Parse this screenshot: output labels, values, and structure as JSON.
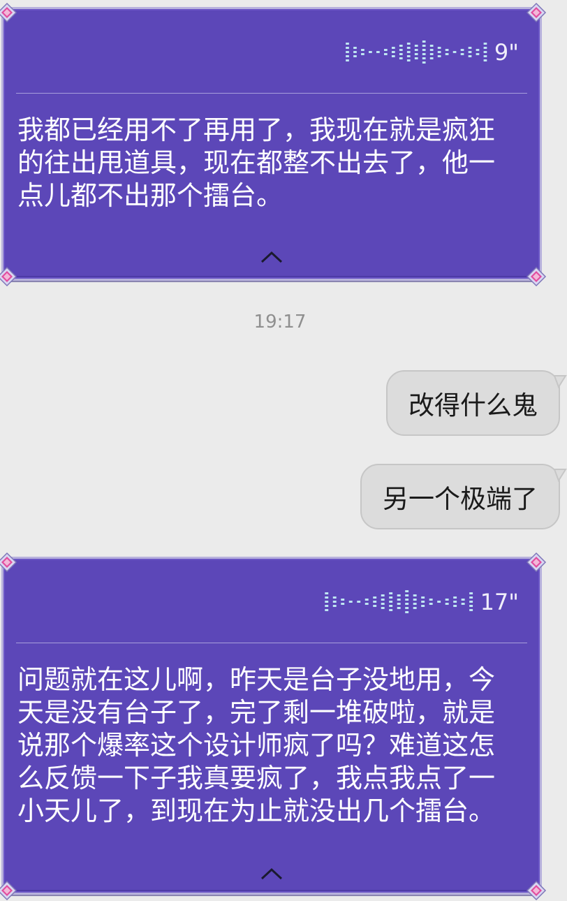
{
  "messages": [
    {
      "type": "voice",
      "direction": "incoming",
      "duration": "9\"",
      "transcript": "我都已经用不了再用了，我现在就是疯狂的往出甩道具，现在都整不出去了，他一点儿都不出那个擂台。"
    },
    {
      "type": "timestamp",
      "text": "19:17"
    },
    {
      "type": "text",
      "direction": "outgoing",
      "text": "改得什么鬼"
    },
    {
      "type": "text",
      "direction": "outgoing",
      "text": "另一个极端了"
    },
    {
      "type": "voice",
      "direction": "incoming",
      "duration": "17\"",
      "transcript": "问题就在这儿啊，昨天是台子没地用，今天是没有台子了，完了剩一堆破啦，就是说那个爆率这个设计师疯了吗？难道这怎么反馈一下子我真要疯了，我点我点了一小天儿了，到现在为止就没出几个擂台。"
    }
  ],
  "icons": {
    "waveform": "sound-waveform-icon",
    "collapse": "chevron-up-icon",
    "corner": "gem-corner-icon"
  },
  "colors": {
    "voice_card_bg": "#5c47b8",
    "voice_card_border": "#b7b1dc",
    "outgoing_bubble_bg": "#dcdcdc",
    "background": "#ebebeb"
  }
}
